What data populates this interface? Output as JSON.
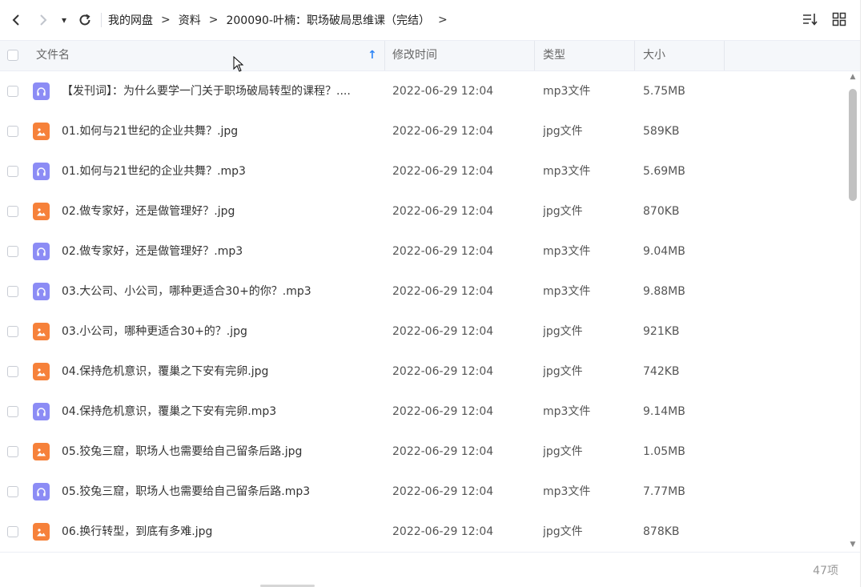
{
  "toolbar": {
    "back_glyph": "〈",
    "forward_glyph": "〉",
    "dropdown_glyph": "▾",
    "refresh_glyph": "↻",
    "breadcrumbs": [
      "我的网盘",
      "资料",
      "200090-叶楠：职场破局思维课（完结）"
    ],
    "crumb_separator": ">"
  },
  "columns": {
    "name": "文件名",
    "modified": "修改时间",
    "type": "类型",
    "size": "大小",
    "sort_indicator": "↑"
  },
  "colors": {
    "audio_icon": "#8c8cf5",
    "image_icon": "#f6813a",
    "sort_arrow": "#2f86f6"
  },
  "files": [
    {
      "name": "【发刊词】：为什么要学一门关于职场破局转型的课程？....",
      "modified": "2022-06-29 12:04",
      "type": "mp3文件",
      "size": "5.75MB",
      "icon": "audio-icon"
    },
    {
      "name": "01.如何与21世纪的企业共舞？.jpg",
      "modified": "2022-06-29 12:04",
      "type": "jpg文件",
      "size": "589KB",
      "icon": "image-icon"
    },
    {
      "name": "01.如何与21世纪的企业共舞？.mp3",
      "modified": "2022-06-29 12:04",
      "type": "mp3文件",
      "size": "5.69MB",
      "icon": "audio-icon"
    },
    {
      "name": "02.做专家好，还是做管理好？.jpg",
      "modified": "2022-06-29 12:04",
      "type": "jpg文件",
      "size": "870KB",
      "icon": "image-icon"
    },
    {
      "name": "02.做专家好，还是做管理好？.mp3",
      "modified": "2022-06-29 12:04",
      "type": "mp3文件",
      "size": "9.04MB",
      "icon": "audio-icon"
    },
    {
      "name": "03.大公司、小公司，哪种更适合30+的你？.mp3",
      "modified": "2022-06-29 12:04",
      "type": "mp3文件",
      "size": "9.88MB",
      "icon": "audio-icon"
    },
    {
      "name": "03.小公司，哪种更适合30+的？.jpg",
      "modified": "2022-06-29 12:04",
      "type": "jpg文件",
      "size": "921KB",
      "icon": "image-icon"
    },
    {
      "name": "04.保持危机意识，覆巢之下安有完卵.jpg",
      "modified": "2022-06-29 12:04",
      "type": "jpg文件",
      "size": "742KB",
      "icon": "image-icon"
    },
    {
      "name": "04.保持危机意识，覆巢之下安有完卵.mp3",
      "modified": "2022-06-29 12:04",
      "type": "mp3文件",
      "size": "9.14MB",
      "icon": "audio-icon"
    },
    {
      "name": "05.狡兔三窟，职场人也需要给自己留条后路.jpg",
      "modified": "2022-06-29 12:04",
      "type": "jpg文件",
      "size": "1.05MB",
      "icon": "image-icon"
    },
    {
      "name": "05.狡兔三窟，职场人也需要给自己留条后路.mp3",
      "modified": "2022-06-29 12:04",
      "type": "mp3文件",
      "size": "7.77MB",
      "icon": "audio-icon"
    },
    {
      "name": "06.换行转型，到底有多难.jpg",
      "modified": "2022-06-29 12:04",
      "type": "jpg文件",
      "size": "878KB",
      "icon": "image-icon"
    }
  ],
  "footer": {
    "count": "47项"
  }
}
